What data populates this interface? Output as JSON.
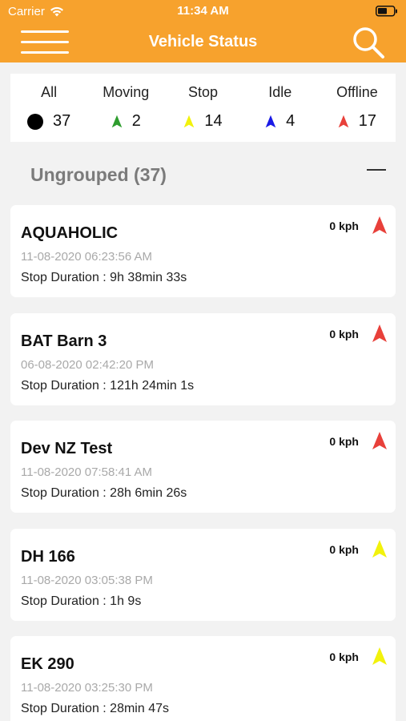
{
  "status_bar": {
    "carrier": "Carrier",
    "time": "11:34 AM"
  },
  "header": {
    "title": "Vehicle Status"
  },
  "summary": [
    {
      "label": "All",
      "count": "37",
      "color": "#000000",
      "icon": "dot-icon"
    },
    {
      "label": "Moving",
      "count": "2",
      "color": "#2e9d2e",
      "icon": "arrow-icon"
    },
    {
      "label": "Stop",
      "count": "14",
      "color": "#f2f20c",
      "icon": "arrow-icon"
    },
    {
      "label": "Idle",
      "count": "4",
      "color": "#1a1ae6",
      "icon": "arrow-icon"
    },
    {
      "label": "Offline",
      "count": "17",
      "color": "#e8403a",
      "icon": "arrow-icon"
    }
  ],
  "group": {
    "title": "Ungrouped (37)"
  },
  "vehicles": [
    {
      "name": "AQUAHOLIC",
      "date": "11-08-2020 06:23:56 AM",
      "duration": "Stop Duration : 9h 38min 33s",
      "speed": "0 kph",
      "status_color": "#e8403a"
    },
    {
      "name": "BAT Barn 3",
      "date": "06-08-2020 02:42:20 PM",
      "duration": "Stop Duration : 121h 24min 1s",
      "speed": "0 kph",
      "status_color": "#e8403a"
    },
    {
      "name": "Dev NZ Test",
      "date": "11-08-2020 07:58:41 AM",
      "duration": "Stop Duration : 28h 6min 26s",
      "speed": "0 kph",
      "status_color": "#e8403a"
    },
    {
      "name": "DH 166",
      "date": "11-08-2020 03:05:38 PM",
      "duration": "Stop Duration : 1h 9s",
      "speed": "0 kph",
      "status_color": "#f2f20c"
    },
    {
      "name": "EK 290",
      "date": "11-08-2020 03:25:30 PM",
      "duration": "Stop Duration : 28min 47s",
      "speed": "0 kph",
      "status_color": "#f2f20c"
    }
  ],
  "colors": {
    "accent": "#f7a22d"
  }
}
